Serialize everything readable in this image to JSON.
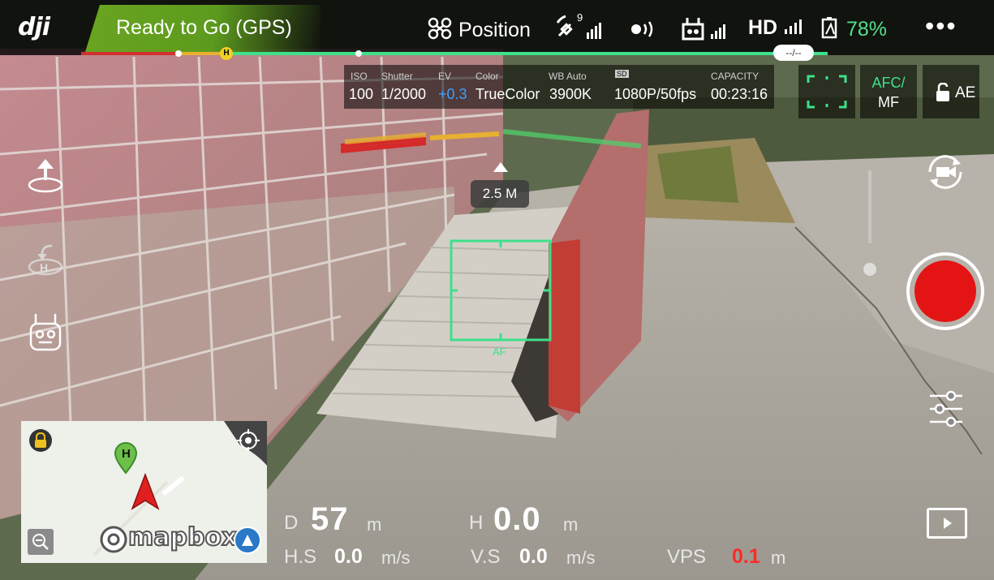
{
  "app": {
    "brand": "dji"
  },
  "status": {
    "text": "Ready to Go (GPS)",
    "color": "#5c9a1e"
  },
  "topbar": {
    "mode": "Position",
    "satellites": "9",
    "hd_label": "HD",
    "battery": "78%",
    "more": "•••",
    "path_label": "--/--",
    "home_marker": "H"
  },
  "camera": {
    "labels": {
      "iso": "ISO",
      "shutter": "Shutter",
      "ev": "EV",
      "color": "Color",
      "wb": "WB  Auto",
      "capacity": "CAPACITY",
      "sd": "SD"
    },
    "values": {
      "iso": "100",
      "shutter": "1/2000",
      "ev": "+0.3",
      "color": "TrueColor",
      "wb": "3900K",
      "resolution": "1080P/50fps",
      "capacity": "00:23:16"
    },
    "focus_mode_top": "AFC/",
    "focus_mode_bottom": "MF",
    "ae": "AE"
  },
  "scene": {
    "obstacle_distance": "2.5 M",
    "af_label": "AF"
  },
  "map": {
    "home_marker": "H",
    "brand": "mapbox"
  },
  "telemetry": {
    "d_label": "D",
    "d_value": "57",
    "d_unit": "m",
    "h_label": "H",
    "h_value": "0.0",
    "h_unit": "m",
    "hs_label": "H.S",
    "hs_value": "0.0",
    "hs_unit": "m/s",
    "vs_label": "V.S",
    "vs_value": "0.0",
    "vs_unit": "m/s",
    "vps_label": "VPS",
    "vps_value": "0.1",
    "vps_unit": "m"
  },
  "colors": {
    "accent_green": "#3ee08a",
    "record_red": "#e51414",
    "warning_red": "#ff2a2a"
  },
  "icons": [
    "takeoff-icon",
    "return-home-icon",
    "remote-controller-icon",
    "camera-switch-icon",
    "record-button",
    "settings-sliders-icon",
    "playback-icon",
    "lock-icon",
    "recenter-icon",
    "zoom-out-icon",
    "compass-icon",
    "drone-icon",
    "satellite-icon",
    "signal-icon",
    "battery-icon"
  ]
}
